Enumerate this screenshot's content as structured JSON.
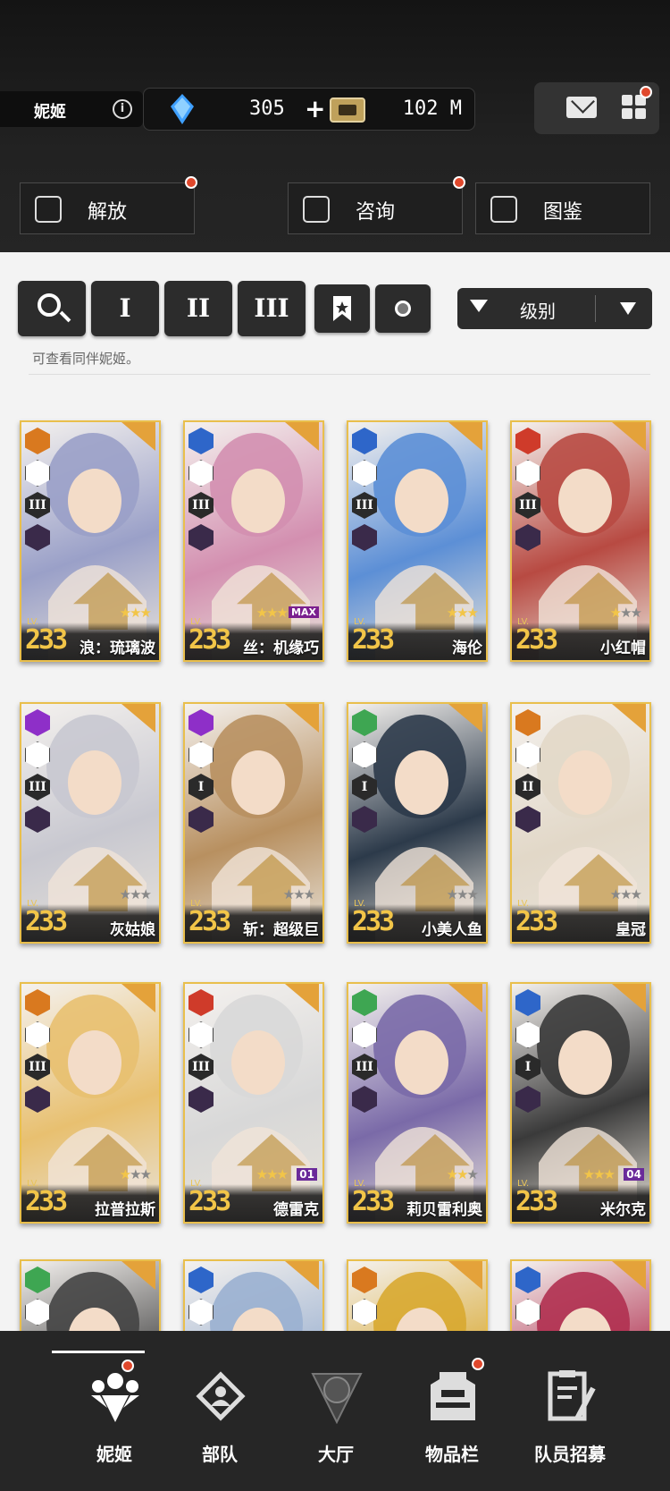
{
  "header": {
    "player_name": "妮姬",
    "info_icon": "info-icon",
    "gems": "305",
    "gems_plus": "+",
    "credits": "102 M",
    "mail_icon": "mail-icon",
    "menu_icon": "grid-icon"
  },
  "nav_buttons": [
    {
      "label": "解放",
      "icon": "limit-break-icon"
    },
    {
      "label": "咨询",
      "icon": "calendar-star-icon"
    },
    {
      "label": "图鉴",
      "icon": "codex-icon"
    }
  ],
  "filters": {
    "search_icon": "search-icon",
    "burst_I": "I",
    "burst_II": "II",
    "burst_III": "III",
    "bookmark_icon": "bookmark-icon",
    "circle_icon": "circle-icon",
    "sort_label": "级别",
    "hint": "可查看同伴妮姬。"
  },
  "cards": [
    {
      "name": "浪：琉璃波",
      "level": "233",
      "lv_tag": "LV.",
      "element": "#d9791f",
      "burst": "III",
      "stars": 3,
      "extra": ""
    },
    {
      "name": "丝：机缘巧",
      "level": "233",
      "lv_tag": "LV.",
      "element": "#2e66c9",
      "burst": "III",
      "stars": 3,
      "extra": "MAX"
    },
    {
      "name": "海伦",
      "level": "233",
      "lv_tag": "LV.",
      "element": "#2e66c9",
      "burst": "III",
      "stars": 3,
      "extra": ""
    },
    {
      "name": "小红帽",
      "level": "233",
      "lv_tag": "LV.",
      "element": "#cf3b2a",
      "burst": "III",
      "stars": 1,
      "extra": ""
    },
    {
      "name": "灰姑娘",
      "level": "233",
      "lv_tag": "LV.",
      "element": "#8e2fc8",
      "burst": "III",
      "stars": 0,
      "extra": ""
    },
    {
      "name": "斩：超级巨",
      "level": "233",
      "lv_tag": "LV.",
      "element": "#8e2fc8",
      "burst": "I",
      "stars": 0,
      "extra": ""
    },
    {
      "name": "小美人鱼",
      "level": "233",
      "lv_tag": "LV.",
      "element": "#3ea652",
      "burst": "I",
      "stars": 0,
      "extra": ""
    },
    {
      "name": "皇冠",
      "level": "233",
      "lv_tag": "LV.",
      "element": "#d9791f",
      "burst": "II",
      "stars": 0,
      "extra": ""
    },
    {
      "name": "拉普拉斯",
      "level": "233",
      "lv_tag": "LV.",
      "element": "#d9791f",
      "burst": "III",
      "stars": 1,
      "extra": ""
    },
    {
      "name": "德雷克",
      "level": "233",
      "lv_tag": "LV.",
      "element": "#cf3b2a",
      "burst": "III",
      "stars": 3,
      "extra": "01"
    },
    {
      "name": "莉贝雷利奥",
      "level": "233",
      "lv_tag": "LV.",
      "element": "#3ea652",
      "burst": "III",
      "stars": 2,
      "extra": ""
    },
    {
      "name": "米尔克",
      "level": "233",
      "lv_tag": "LV.",
      "element": "#2e66c9",
      "burst": "I",
      "stars": 3,
      "extra": "04"
    },
    {
      "name": "",
      "level": "",
      "lv_tag": "",
      "element": "#3ea652",
      "burst": "",
      "stars": 0,
      "extra": ""
    },
    {
      "name": "",
      "level": "",
      "lv_tag": "",
      "element": "#2e66c9",
      "burst": "",
      "stars": 0,
      "extra": ""
    },
    {
      "name": "",
      "level": "",
      "lv_tag": "",
      "element": "#d9791f",
      "burst": "",
      "stars": 0,
      "extra": ""
    },
    {
      "name": "",
      "level": "",
      "lv_tag": "",
      "element": "#2e66c9",
      "burst": "",
      "stars": 0,
      "extra": ""
    }
  ],
  "tabs": [
    {
      "label": "妮姬",
      "icon": "nikke-icon",
      "active": true
    },
    {
      "label": "部队",
      "icon": "squad-icon",
      "active": false
    },
    {
      "label": "大厅",
      "icon": "lobby-icon",
      "active": false
    },
    {
      "label": "物品栏",
      "icon": "inventory-icon",
      "active": false
    },
    {
      "label": "队员招募",
      "icon": "recruit-icon",
      "active": false
    }
  ]
}
